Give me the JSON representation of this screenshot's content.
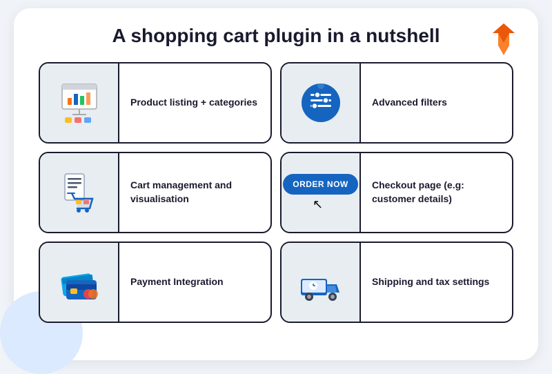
{
  "page": {
    "title": "A shopping cart plugin in a nutshell",
    "logo_alt": "W logo"
  },
  "features": [
    {
      "id": "product-listing",
      "label": "Product listing + categories",
      "icon_type": "product-listing"
    },
    {
      "id": "advanced-filters",
      "label": "Advanced filters",
      "icon_type": "advanced-filters"
    },
    {
      "id": "cart-management",
      "label": "Cart management and visualisation",
      "icon_type": "cart-management"
    },
    {
      "id": "checkout",
      "label": "Checkout page (e.g: customer details)",
      "icon_type": "checkout"
    },
    {
      "id": "payment-integration",
      "label": "Payment Integration",
      "icon_type": "payment-integration"
    },
    {
      "id": "shipping-tax",
      "label": "Shipping and tax settings",
      "icon_type": "shipping-tax"
    }
  ]
}
